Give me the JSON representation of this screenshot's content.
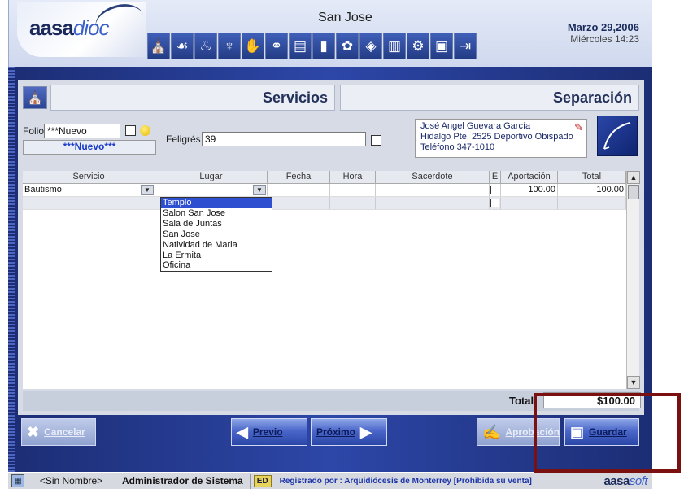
{
  "header": {
    "logo_main": "aasa",
    "logo_accent": "dioc",
    "title": "San Jose",
    "date_line1": "Marzo 29,2006",
    "date_line2": "Miércoles  14:23",
    "toolbar_icons": [
      "church-icon",
      "hands-icon",
      "flame-icon",
      "chalice-icon",
      "handshake-icon",
      "rings-icon",
      "book-icon",
      "chart-icon",
      "globe-icon",
      "folder-icon",
      "books-icon",
      "gears-icon",
      "computer-icon",
      "exit-door-icon"
    ]
  },
  "section": {
    "left_title": "Servicios",
    "right_title": "Separación"
  },
  "form": {
    "folio_label": "Folio",
    "folio_value": "***Nuevo",
    "folio_display": "***Nuevo***",
    "feligres_label": "Feligrés",
    "feligres_value": "39",
    "address_line1": "José Angel Guevara García",
    "address_line2": "Hidalgo Pte. 2525 Deportivo Obispado",
    "address_line3": "Teléfono 347-1010"
  },
  "grid": {
    "columns": [
      "Servicio",
      "Lugar",
      "Fecha",
      "Hora",
      "Sacerdote",
      "E",
      "Aportación",
      "Total"
    ],
    "rows": [
      {
        "servicio": "Bautismo",
        "lugar": "",
        "fecha": "",
        "hora": "",
        "sacerdote": "",
        "aportacion": "100.00",
        "total": "100.00"
      }
    ],
    "lugar_options": [
      "Templo",
      "Salon San Jose",
      "Sala de Juntas",
      "San Jose",
      "Natividad de Maria",
      "La Ermita",
      "Oficina"
    ],
    "selected_option": "Templo"
  },
  "totals": {
    "label": "Total",
    "value": "$100.00"
  },
  "buttons": {
    "cancel": "Cancelar",
    "prev": "Previo",
    "next": "Próximo",
    "approve": "Aprobación",
    "save": "Guardar"
  },
  "status": {
    "user": "<Sin Nombre>",
    "role": "Administrador de Sistema",
    "ed": "ED",
    "registered": "Registrado por : Arquidiócesis de Monterrey  [Prohibida su venta]",
    "brand_main": "aasa",
    "brand_accent": "soft"
  }
}
